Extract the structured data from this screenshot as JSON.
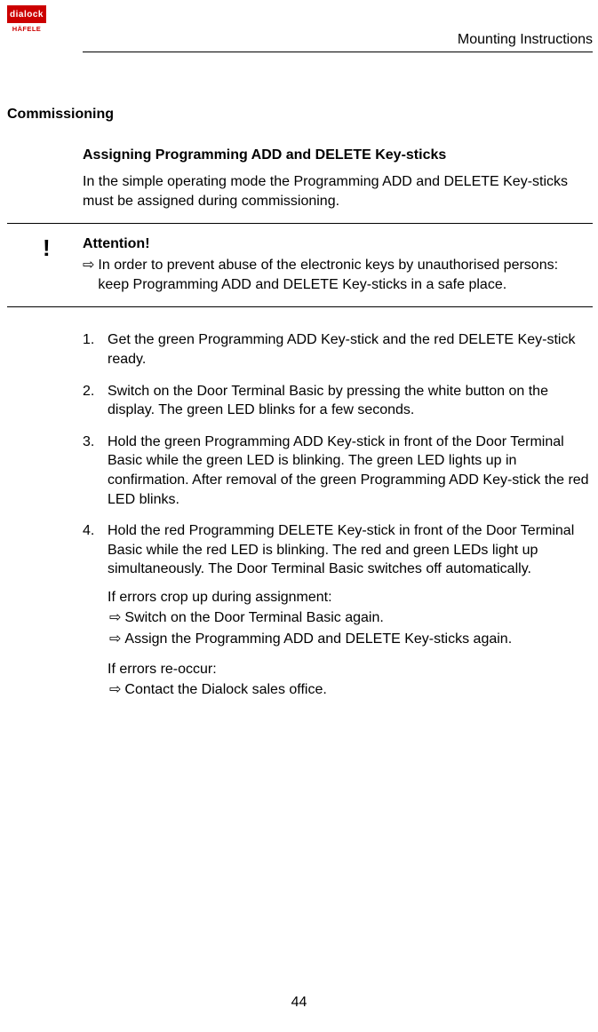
{
  "logo": {
    "brand_top": "dialock",
    "brand_bottom": "HÄFELE"
  },
  "header": {
    "title": "Mounting Instructions"
  },
  "section": {
    "title": "Commissioning",
    "subtitle": "Assigning Programming ADD and DELETE Key-sticks",
    "intro": "In the simple operating mode the Programming ADD and DELETE Key-sticks must be assigned during commissioning."
  },
  "attention": {
    "mark": "!",
    "title": "Attention!",
    "arrow": "⇨",
    "text": "In order to prevent abuse of the electronic keys by unauthorised persons: keep Programming ADD and DELETE Key-sticks in a safe place."
  },
  "steps": [
    {
      "num": "1.",
      "text": "Get the green Programming ADD Key-stick and the red DELETE Key-stick ready."
    },
    {
      "num": "2.",
      "text": "Switch on the Door Terminal Basic by pressing the white button on the display. The green LED blinks for a few seconds."
    },
    {
      "num": "3.",
      "text": "Hold the green Programming ADD Key-stick in front of the Door Terminal Basic while the green LED is blinking. The green LED lights up in confirmation. After removal of the green Programming ADD Key-stick the red LED blinks."
    },
    {
      "num": "4.",
      "text": "Hold the red Programming DELETE Key-stick in front of the Door Terminal Basic  while the red LED is blinking. The red and green LEDs light up simultaneously. The Door Terminal Basic switches off automatically."
    }
  ],
  "errors1": {
    "intro": "If errors crop up during assignment:",
    "arrow": "⇨",
    "items": [
      "Switch on the Door Terminal Basic  again.",
      "Assign the Programming ADD and DELETE Key-sticks again."
    ]
  },
  "errors2": {
    "intro": "If errors re-occur:",
    "arrow": "⇨",
    "items": [
      "Contact the Dialock sales office."
    ]
  },
  "page_number": "44"
}
